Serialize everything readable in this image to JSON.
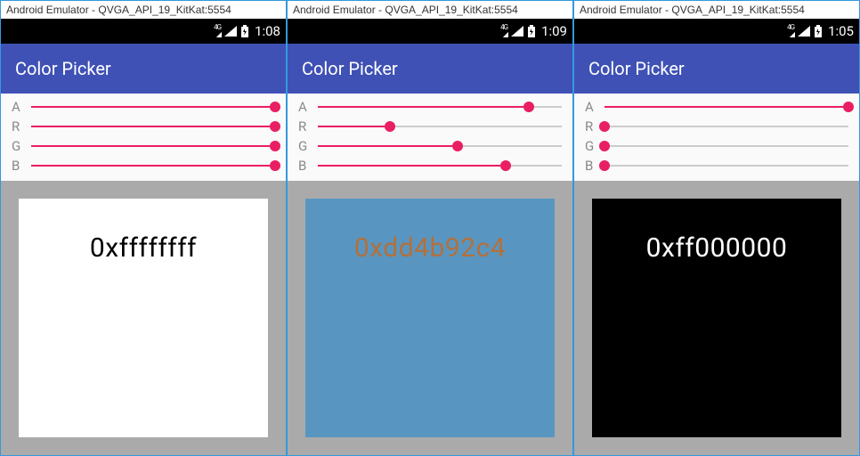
{
  "colors": {
    "accent": "#e91e63",
    "appbar": "#3f51b5",
    "preview_border": "#aaaaaa"
  },
  "emulators": [
    {
      "window_title": "Android Emulator - QVGA_API_19_KitKat:5554",
      "status": {
        "net": "4G",
        "clock": "1:08"
      },
      "app_title": "Color Picker",
      "channels": [
        {
          "label": "A",
          "value": 255
        },
        {
          "label": "R",
          "value": 255
        },
        {
          "label": "G",
          "value": 255
        },
        {
          "label": "B",
          "value": 255
        }
      ],
      "preview": {
        "hex": "0xffffffff",
        "bg": "#ffffff",
        "fg": "#000000"
      }
    },
    {
      "window_title": "Android Emulator - QVGA_API_19_KitKat:5554",
      "status": {
        "net": "4G",
        "clock": "1:09"
      },
      "app_title": "Color Picker",
      "channels": [
        {
          "label": "A",
          "value": 221
        },
        {
          "label": "R",
          "value": 75
        },
        {
          "label": "G",
          "value": 146
        },
        {
          "label": "B",
          "value": 196
        }
      ],
      "preview": {
        "hex": "0xdd4b92c4",
        "bg": "rgba(75,146,196,0.867)",
        "fg": "#b4703b"
      }
    },
    {
      "window_title": "Android Emulator - QVGA_API_19_KitKat:5554",
      "status": {
        "net": "4G",
        "clock": "1:05"
      },
      "app_title": "Color Picker",
      "channels": [
        {
          "label": "A",
          "value": 255
        },
        {
          "label": "R",
          "value": 0
        },
        {
          "label": "G",
          "value": 0
        },
        {
          "label": "B",
          "value": 0
        }
      ],
      "preview": {
        "hex": "0xff000000",
        "bg": "#000000",
        "fg": "#ffffff"
      }
    }
  ]
}
